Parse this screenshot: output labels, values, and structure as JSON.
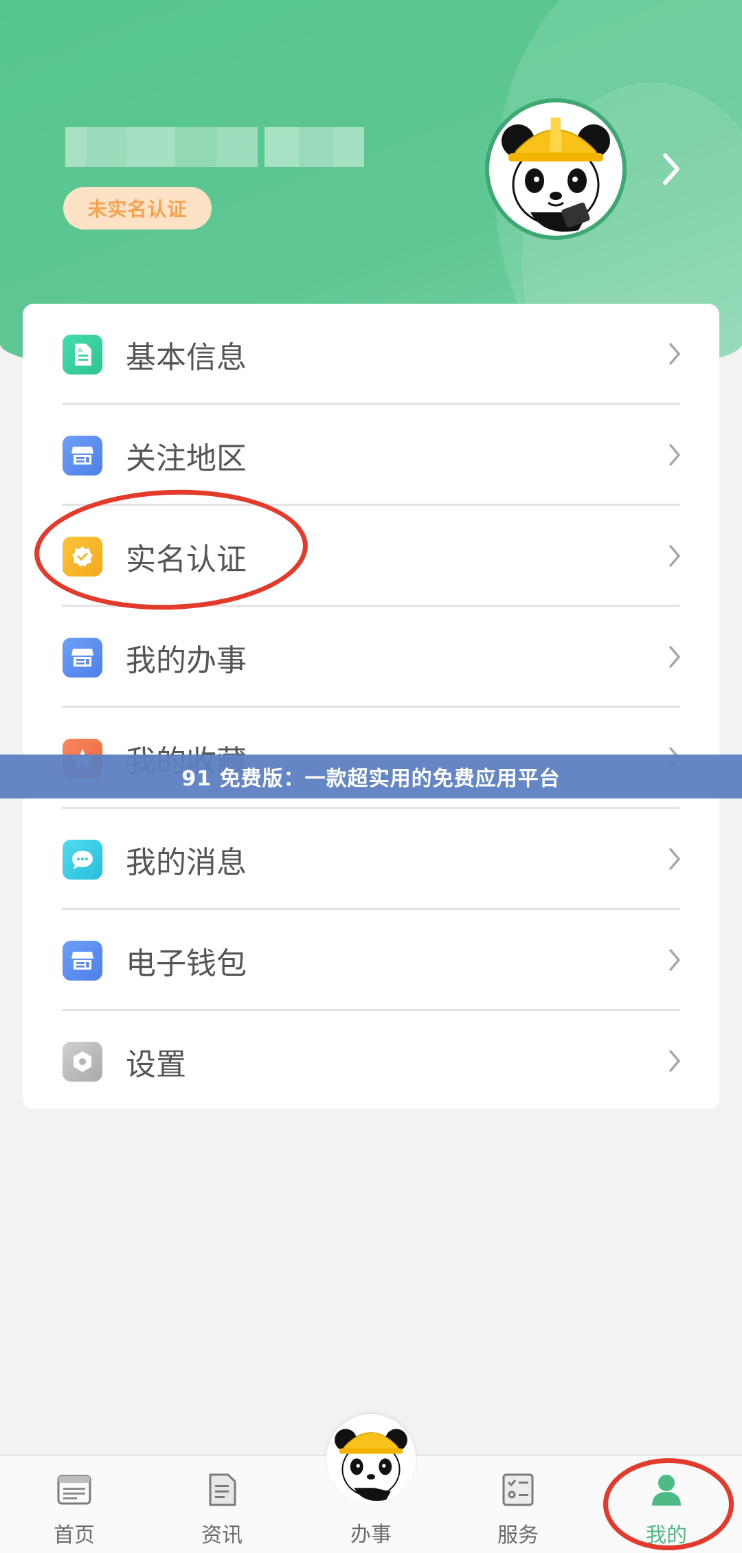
{
  "header": {
    "username": "■■■■■■■ ■■■■",
    "verify_badge": "未实名认证"
  },
  "menu": [
    {
      "label": "基本信息",
      "icon": "document-icon",
      "color": "#3fd2a2"
    },
    {
      "label": "关注地区",
      "icon": "storefront-icon",
      "color": "#5c8df0"
    },
    {
      "label": "实名认证",
      "icon": "verified-badge-icon",
      "color": "#f8b72a"
    },
    {
      "label": "我的办事",
      "icon": "storefront-icon",
      "color": "#5c8df0"
    },
    {
      "label": "我的收藏",
      "icon": "star-icon",
      "color": "#f4744f"
    },
    {
      "label": "我的消息",
      "icon": "chat-bubble-icon",
      "color": "#3ccde6"
    },
    {
      "label": "电子钱包",
      "icon": "storefront-icon",
      "color": "#5c8df0"
    },
    {
      "label": "设置",
      "icon": "hexagon-settings-icon",
      "color": "#bdbdbd"
    }
  ],
  "banner": "91 免费版：一款超实用的免费应用平台",
  "tabs": [
    {
      "label": "首页",
      "icon": "home-browser-icon"
    },
    {
      "label": "资讯",
      "icon": "news-document-icon"
    },
    {
      "label": "办事",
      "icon": "panda-mascot-icon"
    },
    {
      "label": "服务",
      "icon": "checklist-icon"
    },
    {
      "label": "我的",
      "icon": "person-icon",
      "active": true
    }
  ],
  "colors": {
    "header_green": "#56c58d",
    "accent_green": "#4dbb83",
    "badge_orange": "#f7a24e",
    "annotation_red": "#e23a2b"
  }
}
